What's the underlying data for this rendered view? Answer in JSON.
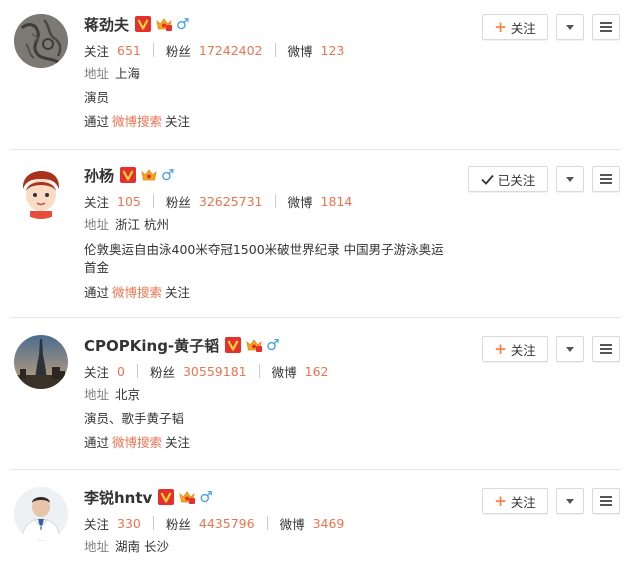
{
  "labels": {
    "follow": "关注",
    "followed": "已关注",
    "followers": "粉丝",
    "posts": "微博",
    "address": "地址",
    "via_prefix": "通过",
    "via_link": "微博搜索",
    "via_suffix": "关注",
    "gender_male": "♂"
  },
  "colors": {
    "accent": "#eb7350",
    "plus": "#ff8140",
    "male": "#3f9de8",
    "verified": "#e5302d",
    "crown": "#f5a623"
  },
  "users": [
    {
      "name": "蒋劲夫",
      "following": "651",
      "followers": "17242402",
      "posts": "123",
      "address": "上海",
      "description": "演员",
      "followed": false,
      "via": true,
      "avatar": "avatar-tattoo"
    },
    {
      "name": "孙杨",
      "following": "105",
      "followers": "32625731",
      "posts": "1814",
      "address": "浙江 杭州",
      "description": "伦敦奥运自由泳400米夺冠1500米破世界纪录 中国男子游泳奥运首金",
      "followed": true,
      "via": true,
      "avatar": "avatar-cartoon"
    },
    {
      "name": "CPOPKing-黄子韬",
      "following": "0",
      "followers": "30559181",
      "posts": "162",
      "address": "北京",
      "description": "演员、歌手黄子韬",
      "followed": false,
      "via": true,
      "avatar": "avatar-tower"
    },
    {
      "name": "李锐hntv",
      "following": "330",
      "followers": "4435796",
      "posts": "3469",
      "address": "湖南 长沙",
      "description": "",
      "followed": false,
      "via": false,
      "avatar": "avatar-person"
    }
  ]
}
